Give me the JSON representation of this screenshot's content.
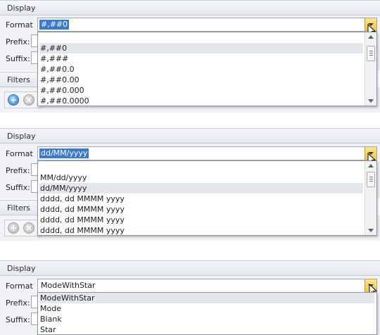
{
  "panels": [
    {
      "group_title": "Display",
      "format_label": "Format",
      "format_value": "#,##0",
      "prefix_label": "Prefix:",
      "suffix_label": "Suffix:",
      "filters_title": "Filters",
      "options": [
        "#,##0",
        "#,###",
        "#,##0.0",
        "#,##0.00",
        "#,##0.000",
        "#,##0.0000"
      ],
      "highlighted": "#,##0"
    },
    {
      "group_title": "Display",
      "format_label": "Format",
      "format_value": "dd/MM/yyyy",
      "prefix_label": "Prefix:",
      "suffix_label": "Suffix:",
      "filters_title": "Filters",
      "options": [
        "MM/dd/yyyy",
        "dd/MM/yyyy",
        "dddd, dd MMMM yyyy",
        "dddd, dd MMMM yyyy",
        "dddd, dd MMMM yyyy",
        "dddd, dd MMMM yyyy"
      ],
      "highlighted": "dd/MM/yyyy"
    },
    {
      "group_title": "Display",
      "format_label": "Format",
      "format_value": "ModeWithStar",
      "prefix_label": "Prefix:",
      "suffix_label": "Suffix:",
      "options": [
        "ModeWithStar",
        "Mode",
        "Blank",
        "Star"
      ],
      "highlighted": "ModeWithStar"
    }
  ],
  "icons": {
    "dropdown_button": "chevron-down-icon",
    "add": "plus-circle-icon",
    "remove": "close-circle-icon",
    "cursor": "mouse-pointer-icon"
  },
  "colors": {
    "selection": "#3a78d6",
    "dropdown_button": "#f6c33a",
    "highlight_row": "#e3e6ea",
    "add_icon": "#2f7fd4"
  }
}
